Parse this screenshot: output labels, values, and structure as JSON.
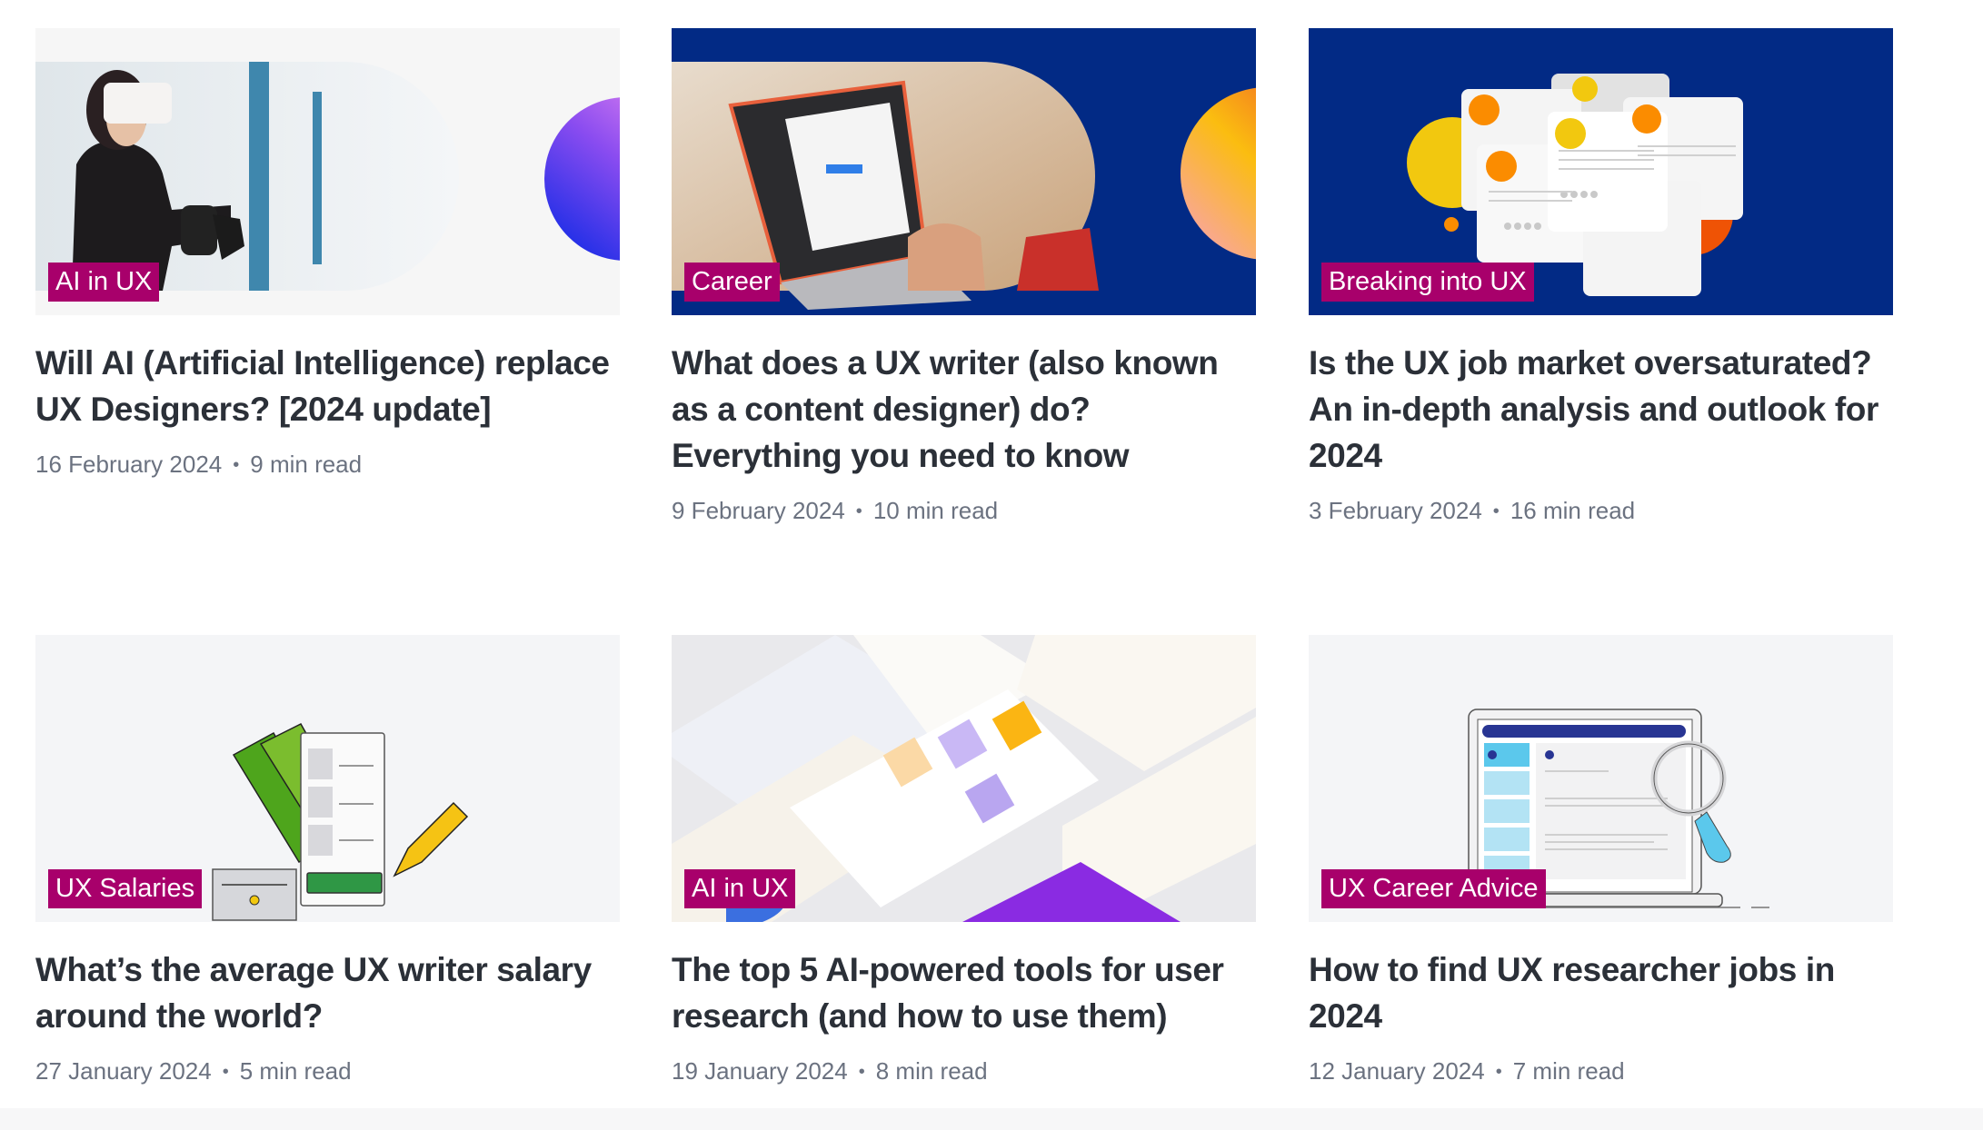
{
  "articles": [
    {
      "tag": "AI in UX",
      "title": "Will AI (Artificial Intelligence) replace UX Designers? [2024 update]",
      "date": "16 February 2024",
      "read_time": "9 min read",
      "thumbnail": "vr-headset-woman-photo"
    },
    {
      "tag": "Career",
      "title": "What does a UX writer (also known as a content designer) do? Everything you need to know",
      "date": "9 February 2024",
      "read_time": "10 min read",
      "thumbnail": "laptop-typing-photo"
    },
    {
      "tag": "Breaking into UX",
      "title": "Is the UX job market oversaturated? An in-depth analysis and outlook for 2024",
      "date": "3 February 2024",
      "read_time": "16 min read",
      "thumbnail": "resume-cards-illustration"
    },
    {
      "tag": "UX Salaries",
      "title": "What’s the average UX writer salary around the world?",
      "date": "27 January 2024",
      "read_time": "5 min read",
      "thumbnail": "money-and-document-illustration"
    },
    {
      "tag": "AI in UX",
      "title": "The top 5 AI-powered tools for user research (and how to use them)",
      "date": "19 January 2024",
      "read_time": "8 min read",
      "thumbnail": "ai-tools-screens-collage"
    },
    {
      "tag": "UX Career Advice",
      "title": "How to find UX researcher jobs in 2024",
      "date": "12 January 2024",
      "read_time": "7 min read",
      "thumbnail": "laptop-magnifier-illustration"
    }
  ],
  "meta_separator": "•",
  "colors": {
    "tag_background": "#a8006b",
    "tag_text": "#ffffff",
    "title_text": "#2b3038",
    "meta_text": "#6b7280",
    "navy_background": "#022a85",
    "light_background": "#f4f5f7"
  }
}
